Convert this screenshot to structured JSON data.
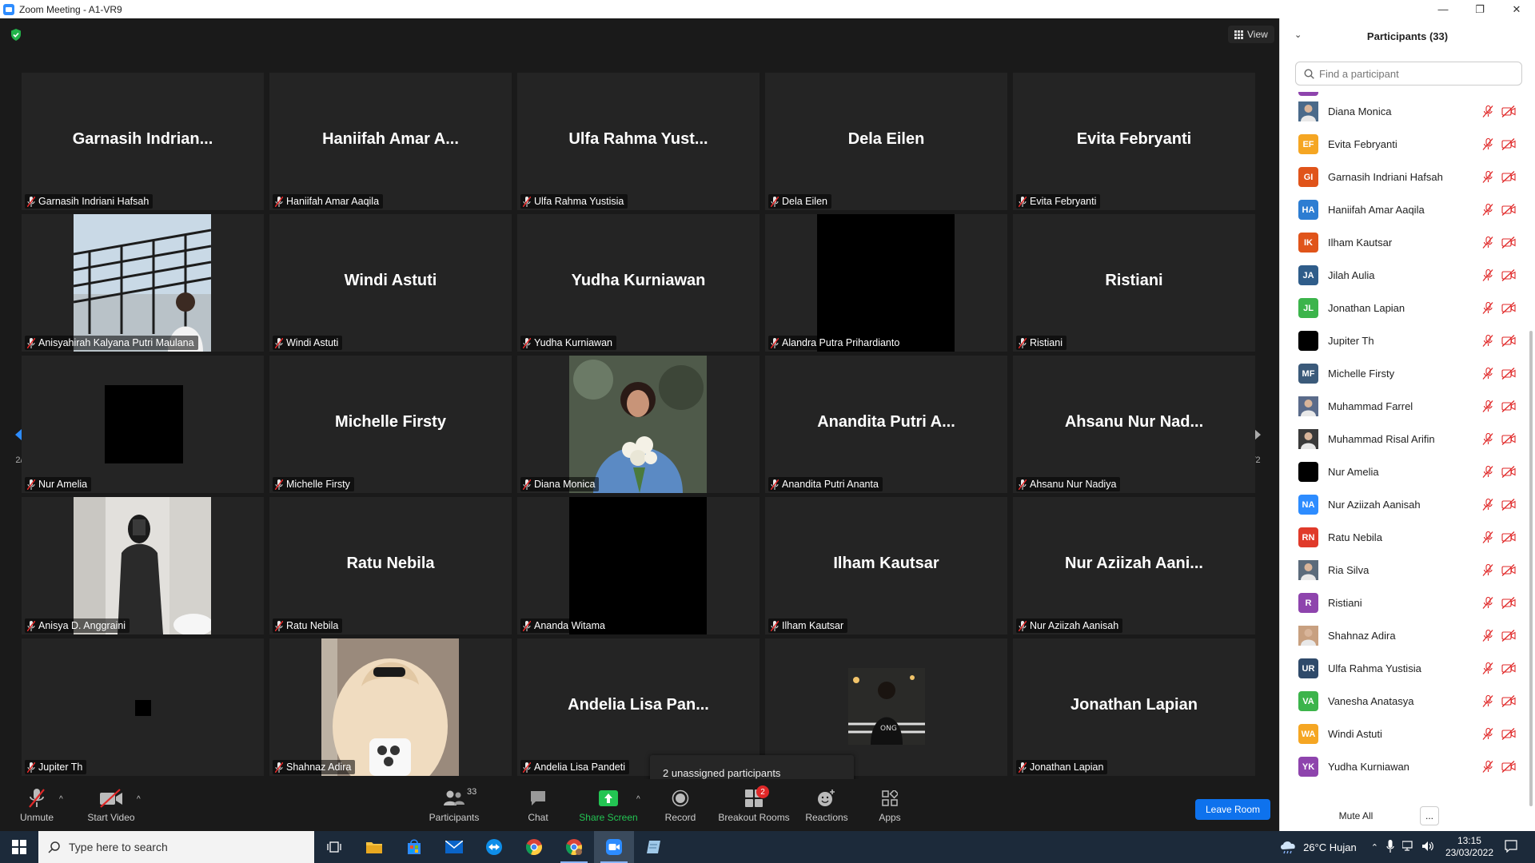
{
  "window": {
    "title": "Zoom Meeting - A1-VR9",
    "minimize": "—",
    "maximize": "❐",
    "close": "✕"
  },
  "view_label": "View",
  "tiles": [
    {
      "big": "Garnasih  Indrian...",
      "label": "Garnasih Indriani Hafsah",
      "kind": "name"
    },
    {
      "big": "Haniifah Amar A...",
      "label": "Haniifah Amar Aaqila",
      "kind": "name"
    },
    {
      "big": "Ulfa Rahma Yust...",
      "label": "Ulfa Rahma Yustisia",
      "kind": "name"
    },
    {
      "big": "Dela Eilen",
      "label": "Dela Eilen",
      "kind": "name"
    },
    {
      "big": "Evita Febryanti",
      "label": "Evita Febryanti",
      "kind": "name"
    },
    {
      "big": "",
      "label": "Anisyahirah Kalyana Putri Maulana",
      "kind": "photo-stairs"
    },
    {
      "big": "Windi Astuti",
      "label": "Windi Astuti",
      "kind": "name"
    },
    {
      "big": "Yudha Kurniawan",
      "label": "Yudha Kurniawan",
      "kind": "name"
    },
    {
      "big": "",
      "label": "Alandra Putra Prihardianto",
      "kind": "black-tall"
    },
    {
      "big": "Ristiani",
      "label": "Ristiani",
      "kind": "name"
    },
    {
      "big": "",
      "label": "Nur Amelia",
      "kind": "black-small"
    },
    {
      "big": "Michelle Firsty",
      "label": "Michelle Firsty",
      "kind": "name"
    },
    {
      "big": "",
      "label": "Diana Monica",
      "kind": "photo-flowers"
    },
    {
      "big": "Anandita Putri A...",
      "label": "Anandita Putri Ananta",
      "kind": "name"
    },
    {
      "big": "Ahsanu Nur Nad...",
      "label": "Ahsanu Nur Nadiya",
      "kind": "name"
    },
    {
      "big": "",
      "label": "Anisya D. Anggraini",
      "kind": "photo-mirror"
    },
    {
      "big": "Ratu Nebila",
      "label": "Ratu Nebila",
      "kind": "name"
    },
    {
      "big": "",
      "label": "Ananda Witama",
      "kind": "black-tall"
    },
    {
      "big": "Ilham Kautsar",
      "label": "Ilham Kautsar",
      "kind": "name"
    },
    {
      "big": "Nur Aziizah Aani...",
      "label": "Nur Aziizah Aanisah",
      "kind": "name"
    },
    {
      "big": "",
      "label": "Jupiter Th",
      "kind": "black-tiny"
    },
    {
      "big": "",
      "label": "Shahnaz Adira",
      "kind": "photo-hair"
    },
    {
      "big": "Andelia Lisa Pan...",
      "label": "Andelia Lisa Pandeti",
      "kind": "name"
    },
    {
      "big": "",
      "label": "al Arifin",
      "kind": "photo-night"
    },
    {
      "big": "Jonathan Lapian",
      "label": "Jonathan Lapian",
      "kind": "name"
    }
  ],
  "pager": {
    "left": "2/2",
    "right": "2/2"
  },
  "toast": "2 unassigned participants",
  "toolbar": {
    "unmute": "Unmute",
    "start_video": "Start Video",
    "participants": "Participants",
    "participants_count": "33",
    "chat": "Chat",
    "share_screen": "Share Screen",
    "record": "Record",
    "breakout_rooms": "Breakout Rooms",
    "breakout_badge": "2",
    "reactions": "Reactions",
    "apps": "Apps",
    "leave_room": "Leave Room"
  },
  "panel": {
    "title": "Participants (33)",
    "search_placeholder": "Find a participant",
    "mute_all": "Mute All",
    "more": "...",
    "participants": [
      {
        "name": "Diana Monica",
        "initials": "",
        "color": "#4a6a8a",
        "photo": true
      },
      {
        "name": "Evita Febryanti",
        "initials": "EF",
        "color": "#f5a623"
      },
      {
        "name": "Garnasih Indriani Hafsah",
        "initials": "GI",
        "color": "#e0541a"
      },
      {
        "name": "Haniifah Amar Aaqila",
        "initials": "HA",
        "color": "#2d7dd2"
      },
      {
        "name": "Ilham Kautsar",
        "initials": "IK",
        "color": "#e0541a"
      },
      {
        "name": "Jilah Aulia",
        "initials": "JA",
        "color": "#2f5d8a"
      },
      {
        "name": "Jonathan Lapian",
        "initials": "JL",
        "color": "#3cb44b"
      },
      {
        "name": "Jupiter Th",
        "initials": "",
        "color": "#000000"
      },
      {
        "name": "Michelle Firsty",
        "initials": "MF",
        "color": "#3b5a7a"
      },
      {
        "name": "Muhammad Farrel",
        "initials": "",
        "color": "#5a6b8a",
        "photo": true
      },
      {
        "name": "Muhammad Risal Arifin",
        "initials": "",
        "color": "#3a3a3a",
        "photo": true
      },
      {
        "name": "Nur Amelia",
        "initials": "",
        "color": "#000000"
      },
      {
        "name": "Nur Aziizah Aanisah",
        "initials": "NA",
        "color": "#2d8cff"
      },
      {
        "name": "Ratu Nebila",
        "initials": "RN",
        "color": "#e03a2a"
      },
      {
        "name": "Ria Silva",
        "initials": "",
        "color": "#5b6b7b",
        "photo": true
      },
      {
        "name": "Ristiani",
        "initials": "R",
        "color": "#8e44ad"
      },
      {
        "name": "Shahnaz Adira",
        "initials": "",
        "color": "#c8a080",
        "photo": true
      },
      {
        "name": "Ulfa Rahma Yustisia",
        "initials": "UR",
        "color": "#2f4a6a"
      },
      {
        "name": "Vanesha Anatasya",
        "initials": "VA",
        "color": "#3cb44b"
      },
      {
        "name": "Windi Astuti",
        "initials": "WA",
        "color": "#f5a623"
      },
      {
        "name": "Yudha Kurniawan",
        "initials": "YK",
        "color": "#8e44ad"
      }
    ]
  },
  "taskbar": {
    "search_placeholder": "Type here to search",
    "weather": "26°C  Hujan",
    "time": "13:15",
    "date": "23/03/2022"
  }
}
